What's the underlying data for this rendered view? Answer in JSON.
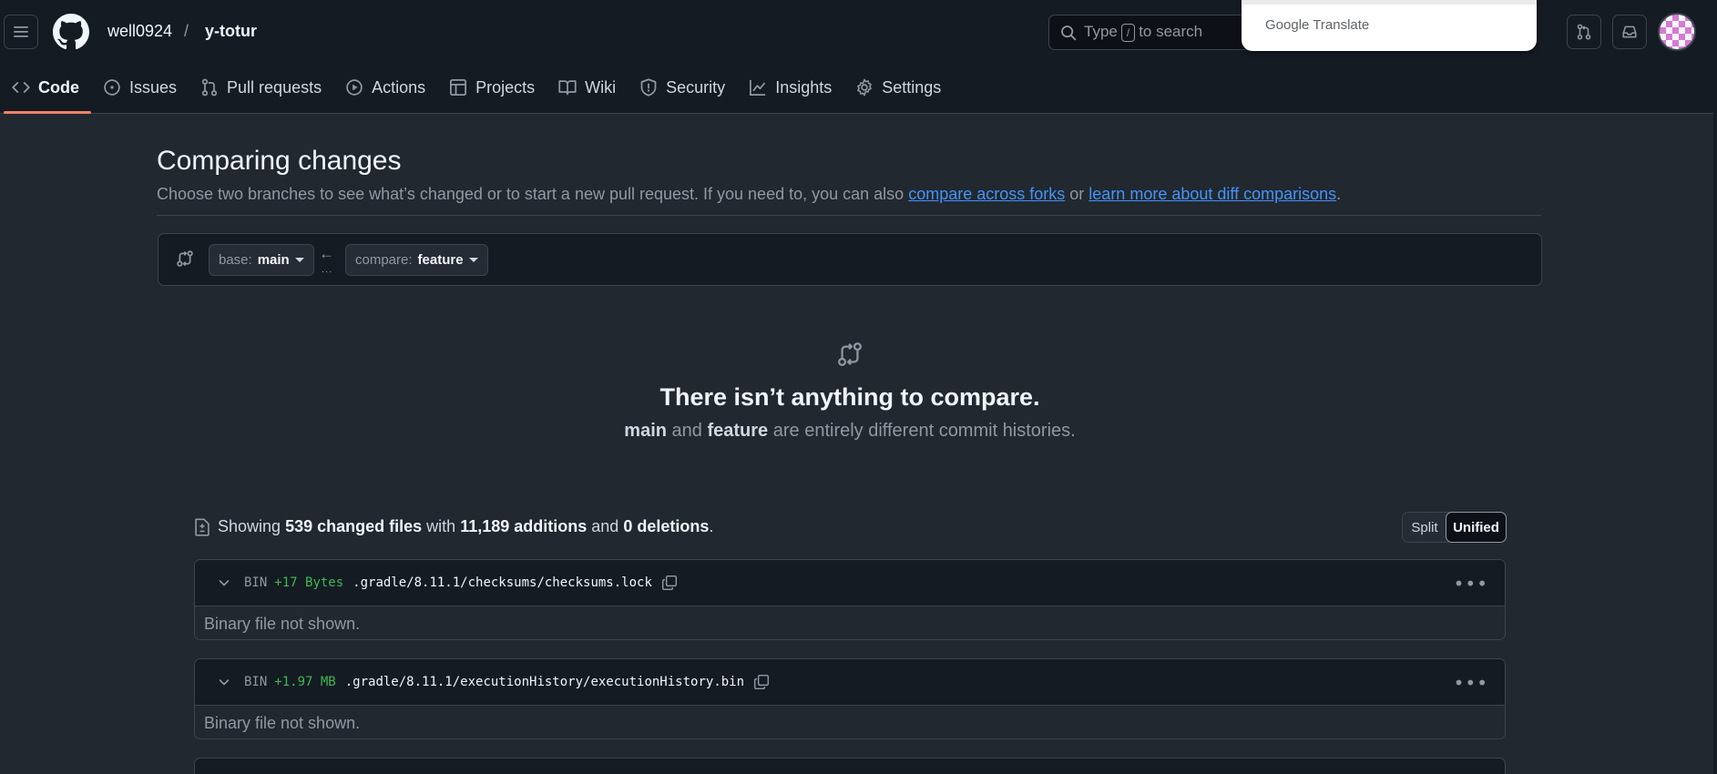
{
  "header": {
    "owner": "well0924",
    "slash": "/",
    "repo": "y-totur",
    "search_prefix": "Type",
    "search_key": "/",
    "search_suffix": "to search",
    "translate_brand": "Google",
    "translate_word": "Translate"
  },
  "tabs": [
    {
      "label": "Code",
      "icon": "code-icon"
    },
    {
      "label": "Issues",
      "icon": "issue-icon"
    },
    {
      "label": "Pull requests",
      "icon": "pull-request-icon"
    },
    {
      "label": "Actions",
      "icon": "play-icon"
    },
    {
      "label": "Projects",
      "icon": "table-icon"
    },
    {
      "label": "Wiki",
      "icon": "book-icon"
    },
    {
      "label": "Security",
      "icon": "shield-icon"
    },
    {
      "label": "Insights",
      "icon": "graph-icon"
    },
    {
      "label": "Settings",
      "icon": "gear-icon"
    }
  ],
  "main": {
    "title": "Comparing changes",
    "subtitle_text": "Choose two branches to see what’s changed or to start a new pull request. If you need to, you can also",
    "link_forks": "compare across forks",
    "subtitle_or": "or",
    "link_learn": "learn more about diff comparisons",
    "subtitle_end": ".",
    "base_prefix": "base:",
    "base_branch": "main",
    "compare_prefix": "compare:",
    "compare_branch": "feature",
    "range_arrow": "←",
    "range_dots": "...",
    "blank_title": "There isn’t anything to compare.",
    "blank_branch_a": "main",
    "blank_and": "and",
    "blank_branch_b": "feature",
    "blank_rest": "are entirely different commit histories."
  },
  "toc": {
    "showing": "Showing",
    "files": "539 changed files",
    "with": "with",
    "additions": "11,189 additions",
    "and": "and",
    "deletions": "0 deletions",
    "end": "."
  },
  "view_toggle": {
    "split": "Split",
    "unified": "Unified"
  },
  "files": [
    {
      "type": "BIN",
      "delta": "+17 Bytes",
      "path": ".gradle/8.11.1/checksums/checksums.lock",
      "body": "Binary file not shown."
    },
    {
      "type": "BIN",
      "delta": "+1.97 MB",
      "path": ".gradle/8.11.1/executionHistory/executionHistory.bin",
      "body": "Binary file not shown."
    }
  ],
  "colors": {
    "accent": "#f78166",
    "link": "#4493f8",
    "addition": "#3fb950"
  }
}
